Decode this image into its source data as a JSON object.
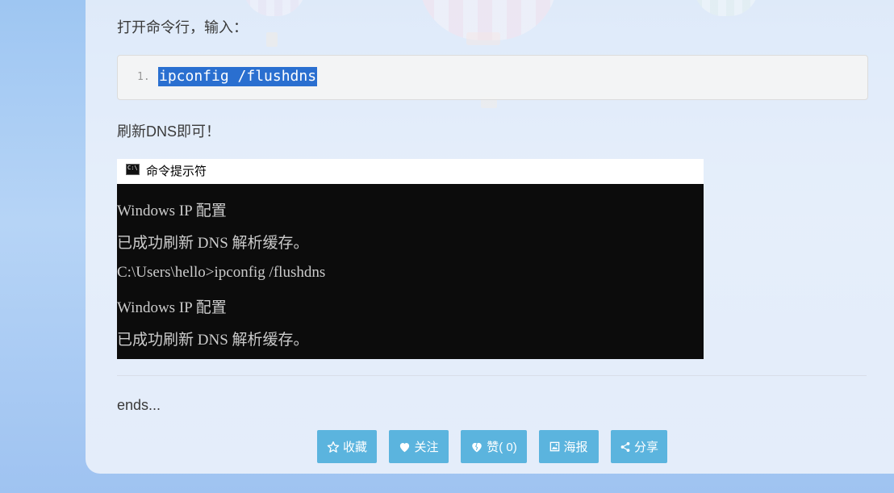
{
  "article": {
    "intro": "打开命令行，输入：",
    "code": {
      "line_number": "1.",
      "command": "ipconfig /flushdns"
    },
    "after_code": "刷新DNS即可！",
    "closing": "ends..."
  },
  "cmd_window": {
    "title": "命令提示符",
    "lines": [
      "Windows IP 配置",
      "已成功刷新 DNS 解析缓存。",
      "C:\\Users\\hello>ipconfig /flushdns",
      "Windows IP 配置",
      "已成功刷新 DNS 解析缓存。"
    ]
  },
  "actions": {
    "favorite": {
      "label": "收藏",
      "icon": "star-outline-icon"
    },
    "follow": {
      "label": "关注",
      "icon": "heart-icon"
    },
    "like": {
      "label": "赞( 0)",
      "icon": "heart-broken-icon"
    },
    "poster": {
      "label": "海报",
      "icon": "image-icon"
    },
    "share": {
      "label": "分享",
      "icon": "share-icon"
    },
    "color": "#5bb4de"
  },
  "colors": {
    "selection": "#2a6fd0",
    "terminal_bg": "#0c0c0c",
    "terminal_text": "#cccccc"
  }
}
